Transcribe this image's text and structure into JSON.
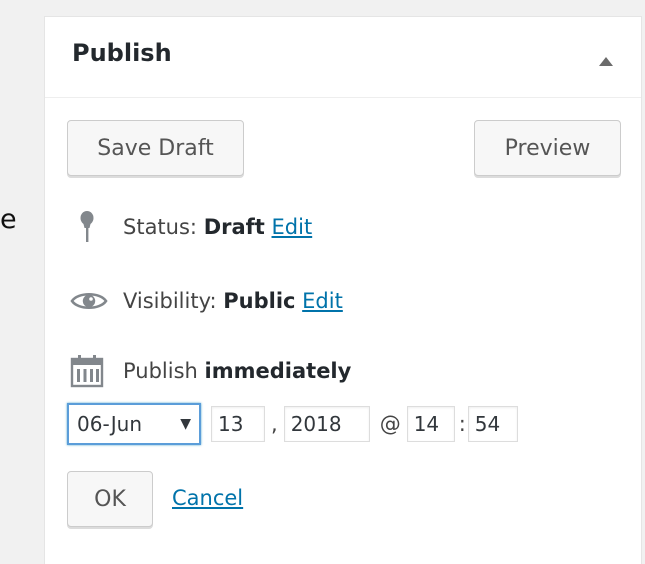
{
  "left_edge_text": "e",
  "publish_box": {
    "title": "Publish",
    "toggle_icon": "triangle-up-icon",
    "buttons": {
      "save_draft": "Save Draft",
      "preview": "Preview"
    },
    "status": {
      "icon": "pushpin-icon",
      "label": "Status:",
      "value": "Draft",
      "edit": "Edit"
    },
    "visibility": {
      "icon": "eye-icon",
      "label": "Visibility:",
      "value": "Public",
      "edit": "Edit"
    },
    "schedule": {
      "icon": "calendar-icon",
      "label": "Publish",
      "value": "immediately",
      "month": "06-Jun",
      "day": "13",
      "comma": ",",
      "year": "2018",
      "at": "@",
      "hour": "14",
      "colon": ":",
      "minute": "54",
      "ok": "OK",
      "cancel": "Cancel"
    }
  },
  "colors": {
    "link": "#0073aa",
    "focus_border": "#5b9dd9",
    "icon": "#82878c"
  }
}
